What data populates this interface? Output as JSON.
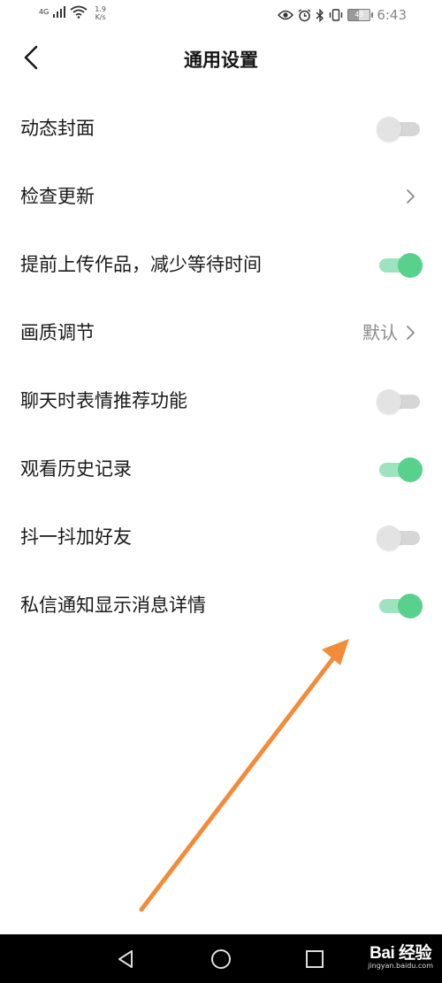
{
  "status_bar": {
    "network_type": "4G",
    "speed_value": "1.9",
    "speed_unit": "K/s",
    "battery": "49",
    "time": "6:43"
  },
  "header": {
    "title": "通用设置"
  },
  "settings": [
    {
      "label": "动态封面",
      "control": "toggle",
      "on": false
    },
    {
      "label": "检查更新",
      "control": "chevron"
    },
    {
      "label": "提前上传作品，减少等待时间",
      "control": "toggle",
      "on": true
    },
    {
      "label": "画质调节",
      "control": "chevron",
      "value": "默认"
    },
    {
      "label": "聊天时表情推荐功能",
      "control": "toggle",
      "on": false
    },
    {
      "label": "观看历史记录",
      "control": "toggle",
      "on": true
    },
    {
      "label": "抖一抖加好友",
      "control": "toggle",
      "on": false
    },
    {
      "label": "私信通知显示消息详情",
      "control": "toggle",
      "on": true
    }
  ],
  "colors": {
    "toggle_on_knob": "#57d18c",
    "toggle_on_track": "#9ee3bf",
    "toggle_off_knob": "#e3e3e3",
    "toggle_off_track": "#d6d6d6",
    "annotation_arrow": "#f28c3a"
  },
  "nav_bar": {
    "icons": [
      "back-triangle-icon",
      "home-circle-icon",
      "recents-square-icon"
    ]
  },
  "watermark": {
    "logo": "Bai 经验",
    "url": "jingyan.baidu.com"
  }
}
